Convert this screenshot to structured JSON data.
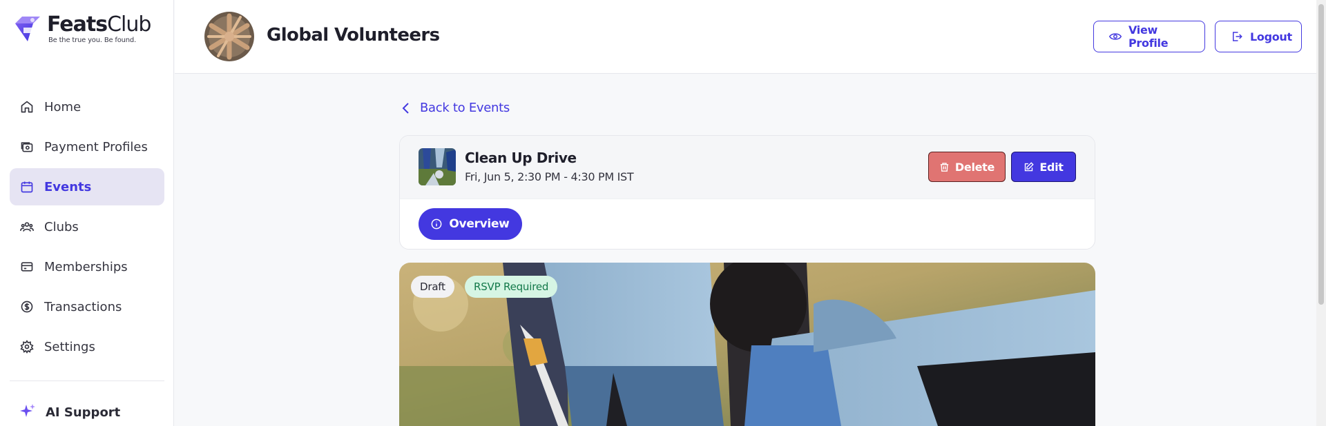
{
  "brand": {
    "name_bold": "Feats",
    "name_light": "Club",
    "tagline": "Be the true you. Be found."
  },
  "sidebar": {
    "items": [
      {
        "label": "Home",
        "icon": "home-icon",
        "active": false
      },
      {
        "label": "Payment Profiles",
        "icon": "payment-profile-icon",
        "active": false
      },
      {
        "label": "Events",
        "icon": "calendar-icon",
        "active": true
      },
      {
        "label": "Clubs",
        "icon": "users-icon",
        "active": false
      },
      {
        "label": "Memberships",
        "icon": "membership-card-icon",
        "active": false
      },
      {
        "label": "Transactions",
        "icon": "dollar-circle-icon",
        "active": false
      },
      {
        "label": "Settings",
        "icon": "gear-icon",
        "active": false
      }
    ],
    "ai_support": "AI Support"
  },
  "header": {
    "org_name": "Global Volunteers",
    "view_profile": "View Profile",
    "logout": "Logout"
  },
  "main": {
    "back_link": "Back to Events",
    "event": {
      "title": "Clean Up Drive",
      "datetime": "Fri, Jun 5, 2:30 PM - 4:30 PM IST",
      "delete_label": "Delete",
      "edit_label": "Edit"
    },
    "tabs": [
      {
        "label": "Overview",
        "active": true
      }
    ],
    "badges": {
      "draft": "Draft",
      "rsvp": "RSVP Required"
    }
  },
  "colors": {
    "accent": "#4338e0",
    "active_nav_bg": "#e6e4f3",
    "delete": "#e07472",
    "rsvp_bg": "#d6f5e4",
    "rsvp_text": "#13794a"
  }
}
